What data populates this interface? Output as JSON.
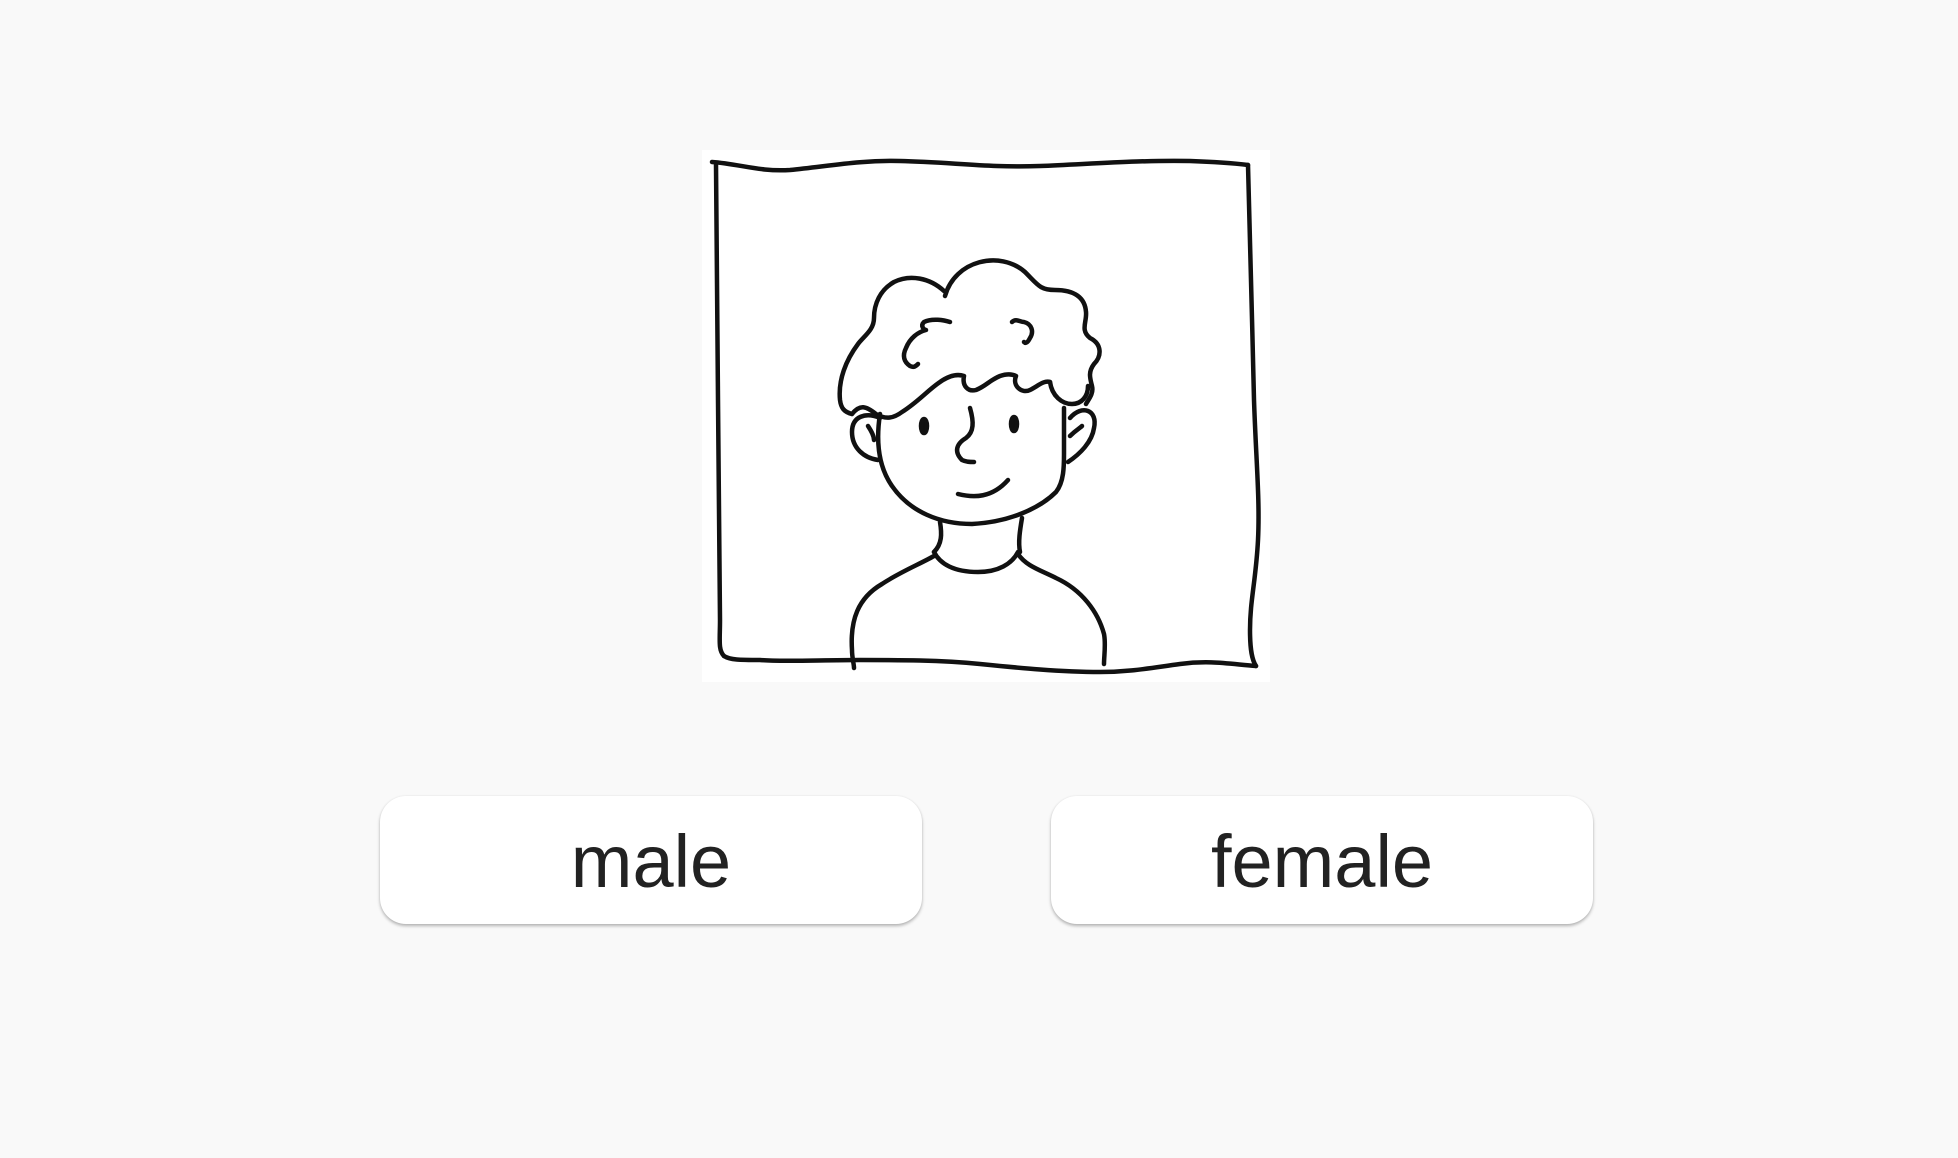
{
  "quiz": {
    "image": {
      "icon": "boy-portrait-illustration-icon",
      "stroke_color": "#111111",
      "background": "#ffffff"
    },
    "options": [
      {
        "label": "male"
      },
      {
        "label": "female"
      }
    ]
  },
  "colors": {
    "page_background": "#f9f9f9",
    "button_background": "#ffffff",
    "button_text": "#222222"
  }
}
